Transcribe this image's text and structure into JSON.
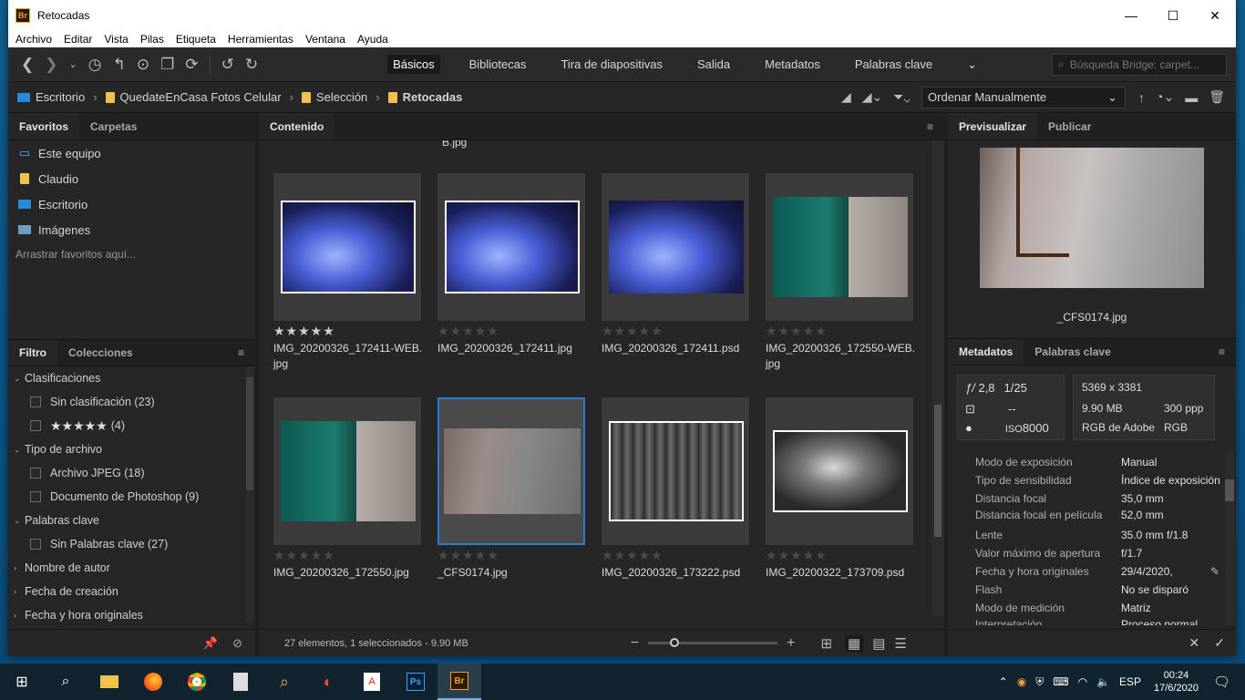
{
  "window": {
    "title": "Retocadas",
    "minimize": "—",
    "maximize": "☐",
    "close": "✕"
  },
  "menu": [
    "Archivo",
    "Editar",
    "Vista",
    "Pilas",
    "Etiqueta",
    "Herramientas",
    "Ventana",
    "Ayuda"
  ],
  "workspaces": [
    "Básicos",
    "Bibliotecas",
    "Tira de diapositivas",
    "Salida",
    "Metadatos",
    "Palabras clave"
  ],
  "search": {
    "placeholder": "Búsqueda Bridge: carpet..."
  },
  "breadcrumb": [
    "Escritorio",
    "QuedateEnCasa Fotos Celular",
    "Selección",
    "Retocadas"
  ],
  "sort": {
    "label": "Ordenar Manualmente"
  },
  "left": {
    "tabs": [
      "Favoritos",
      "Carpetas"
    ],
    "favorites": [
      "Este equipo",
      "Claudio",
      "Escritorio",
      "Imágenes"
    ],
    "drag_hint": "Arrastrar favoritos aquí...",
    "filter_tabs": [
      "Filtro",
      "Colecciones"
    ],
    "filters": {
      "ratings_header": "Clasificaciones",
      "no_rating": "Sin clasificación (23)",
      "five_stars": "★★★★★",
      "five_stars_count": "(4)",
      "type_header": "Tipo de archivo",
      "jpeg": "Archivo JPEG (18)",
      "psd": "Documento de Photoshop (9)",
      "kw_header": "Palabras clave",
      "no_kw": "Sin Palabras clave (27)",
      "author": "Nombre de autor",
      "created": "Fecha de creación",
      "original_dt": "Fecha y hora originales"
    }
  },
  "content": {
    "tab": "Contenido",
    "top_partial": "B.jpg",
    "items": [
      {
        "name": "IMG_20200326_172411-WEB.jpg",
        "stars": "★★★★★",
        "rated": true
      },
      {
        "name": "IMG_20200326_172411.jpg",
        "stars": "★★★★★",
        "rated": false
      },
      {
        "name": "IMG_20200326_172411.psd",
        "stars": "★★★★★",
        "rated": false
      },
      {
        "name": "IMG_20200326_172550-WEB.jpg",
        "stars": "★★★★★",
        "rated": false
      },
      {
        "name": "IMG_20200326_172550.jpg",
        "stars": "★★★★★",
        "rated": false
      },
      {
        "name": "_CFS0174.jpg",
        "stars": "★★★★★",
        "rated": false
      },
      {
        "name": "IMG_20200326_173222.psd",
        "stars": "★★★★★",
        "rated": false
      },
      {
        "name": "IMG_20200322_173709.psd",
        "stars": "★★★★★",
        "rated": false
      }
    ],
    "status": "27 elementos, 1 seleccionados - 9.90 MB"
  },
  "right": {
    "tabs": [
      "Previsualizar",
      "Publicar"
    ],
    "preview_name": "_CFS0174.jpg",
    "meta_tabs": [
      "Metadatos",
      "Palabras clave"
    ],
    "camera": {
      "aperture": "2,8",
      "shutter": "1/25",
      "wb": "--",
      "iso": "8000"
    },
    "file": {
      "dims": "5369 x 3381",
      "size": "9.90 MB",
      "ppi": "300 ppp",
      "profile": "RGB de Adobe",
      "mode": "RGB"
    },
    "rows": [
      {
        "k": "Modo de exposición",
        "v": "Manual"
      },
      {
        "k": "Tipo de sensibilidad",
        "v": "Índice de exposición"
      },
      {
        "k": "Distancia focal",
        "v": "35,0 mm"
      },
      {
        "k": "Distancia focal en película",
        "v": "52,0 mm"
      },
      {
        "k": "Lente",
        "v": "35.0 mm f/1.8"
      },
      {
        "k": "Valor máximo de apertura",
        "v": "f/1.7"
      },
      {
        "k": "Fecha y hora originales",
        "v": "29/4/2020,"
      },
      {
        "k": "Flash",
        "v": "No se disparó"
      },
      {
        "k": "Modo de medición",
        "v": "Matriz"
      },
      {
        "k": "Interpretación",
        "v": "Proceso normal"
      }
    ]
  },
  "taskbar": {
    "lang": "ESP",
    "time": "00:24",
    "date": "17/6/2020"
  }
}
